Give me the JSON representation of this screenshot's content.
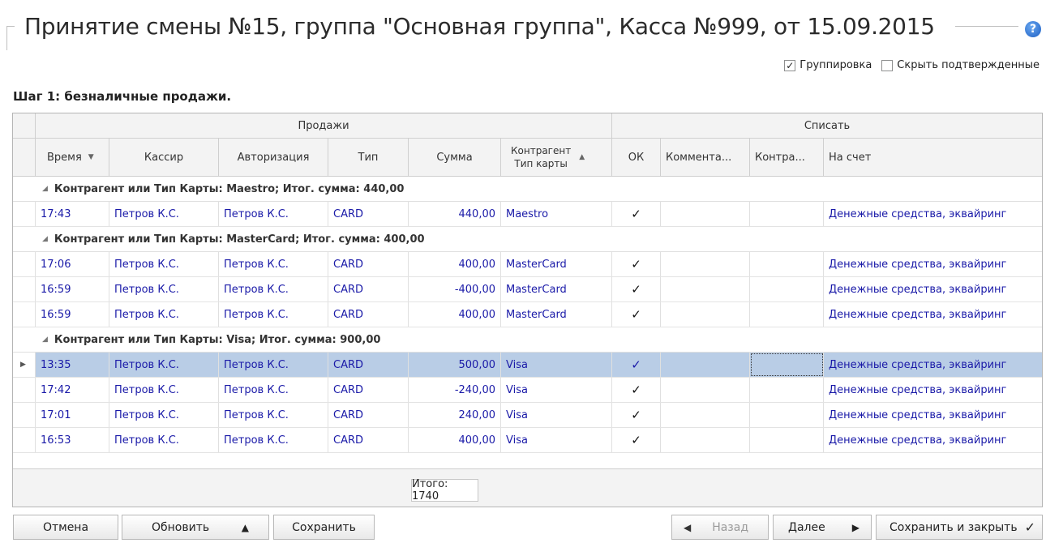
{
  "title": "Принятие смены №15, группа \"Основная группа\", Касса №999, от 15.09.2015",
  "options": {
    "grouping_label": "Группировка",
    "grouping_checked": true,
    "hide_confirmed_label": "Скрыть подтвержденные",
    "hide_confirmed_checked": false
  },
  "step_label": "Шаг 1: безналичные продажи.",
  "grid": {
    "band_sales": "Продажи",
    "band_writeoff": "Списать",
    "columns": {
      "time": "Время",
      "cashier": "Кассир",
      "authorization": "Авторизация",
      "type": "Тип",
      "sum": "Сумма",
      "counterparty_line1": "Контрагент",
      "counterparty_line2": "Тип карты",
      "ok": "ОК",
      "comment": "Коммента...",
      "contra": "Контра...",
      "account": "На счет"
    },
    "groups": [
      {
        "header": "Контрагент или Тип Карты: Maestro; Итог. сумма: 440,00",
        "rows": [
          {
            "time": "17:43",
            "cashier": "Петров К.С.",
            "auth": "Петров К.С.",
            "type": "CARD",
            "sum": "440,00",
            "card": "Maestro",
            "ok": "✓",
            "account": "Денежные средства, эквайринг"
          }
        ]
      },
      {
        "header": "Контрагент или Тип Карты: MasterCard; Итог. сумма: 400,00",
        "rows": [
          {
            "time": "17:06",
            "cashier": "Петров К.С.",
            "auth": "Петров К.С.",
            "type": "CARD",
            "sum": "400,00",
            "card": "MasterCard",
            "ok": "✓",
            "account": "Денежные средства, эквайринг"
          },
          {
            "time": "16:59",
            "cashier": "Петров К.С.",
            "auth": "Петров К.С.",
            "type": "CARD",
            "sum": "-400,00",
            "card": "MasterCard",
            "ok": "✓",
            "account": "Денежные средства, эквайринг"
          },
          {
            "time": "16:59",
            "cashier": "Петров К.С.",
            "auth": "Петров К.С.",
            "type": "CARD",
            "sum": "400,00",
            "card": "MasterCard",
            "ok": "✓",
            "account": "Денежные средства, эквайринг"
          }
        ]
      },
      {
        "header": "Контрагент или Тип Карты: Visa; Итог. сумма: 900,00",
        "rows": [
          {
            "time": "13:35",
            "cashier": "Петров К.С.",
            "auth": "Петров К.С.",
            "type": "CARD",
            "sum": "500,00",
            "card": "Visa",
            "ok": "✓",
            "account": "Денежные средства, эквайринг"
          },
          {
            "time": "17:42",
            "cashier": "Петров К.С.",
            "auth": "Петров К.С.",
            "type": "CARD",
            "sum": "-240,00",
            "card": "Visa",
            "ok": "✓",
            "account": "Денежные средства, эквайринг"
          },
          {
            "time": "17:01",
            "cashier": "Петров К.С.",
            "auth": "Петров К.С.",
            "type": "CARD",
            "sum": "240,00",
            "card": "Visa",
            "ok": "✓",
            "account": "Денежные средства, эквайринг"
          },
          {
            "time": "16:53",
            "cashier": "Петров К.С.",
            "auth": "Петров К.С.",
            "type": "CARD",
            "sum": "400,00",
            "card": "Visa",
            "ok": "✓",
            "account": "Денежные средства, эквайринг"
          }
        ]
      }
    ],
    "total": "Итого: 1740"
  },
  "buttons": {
    "cancel": "Отмена",
    "refresh": "Обновить",
    "save": "Сохранить",
    "back": "Назад",
    "next": "Далее",
    "save_close": "Сохранить и закрыть"
  }
}
